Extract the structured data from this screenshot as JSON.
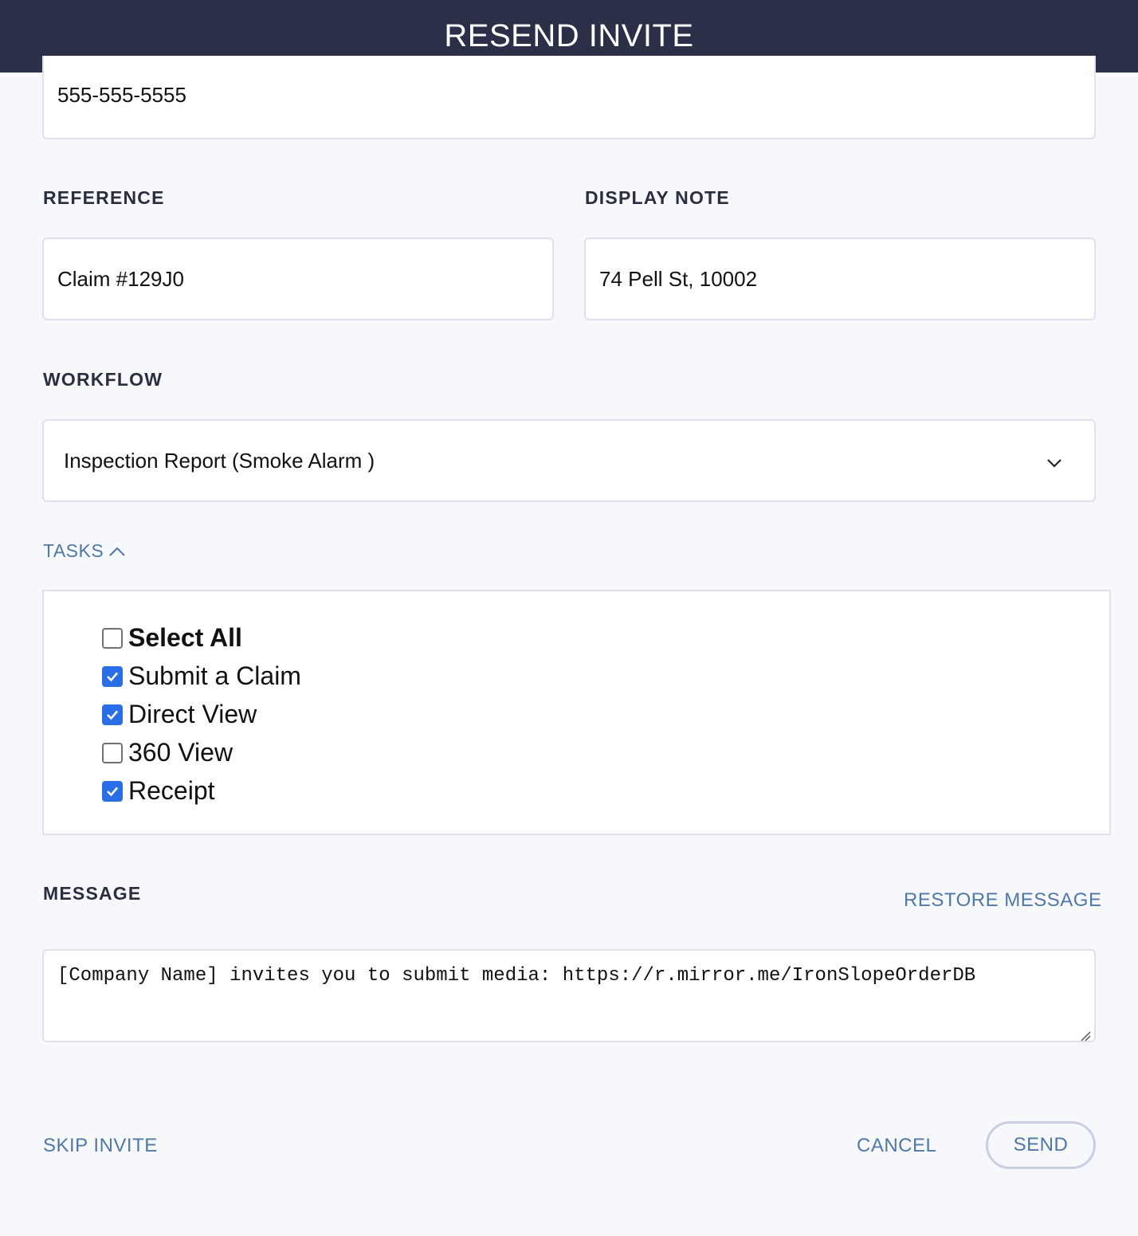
{
  "header": {
    "title": "RESEND INVITE"
  },
  "phone": {
    "value": "555-555-5555"
  },
  "reference": {
    "label": "REFERENCE",
    "value": "Claim #129J0"
  },
  "display_note": {
    "label": "DISPLAY NOTE",
    "value": "74 Pell St, 10002"
  },
  "workflow": {
    "label": "WORKFLOW",
    "selected": "Inspection Report (Smoke Alarm )"
  },
  "tasks": {
    "toggle_label": "TASKS",
    "expanded": true,
    "items": [
      {
        "label": "Select All",
        "checked": false
      },
      {
        "label": "Submit a Claim",
        "checked": true
      },
      {
        "label": "Direct View",
        "checked": true
      },
      {
        "label": "360 View",
        "checked": false
      },
      {
        "label": "Receipt",
        "checked": true
      }
    ]
  },
  "message": {
    "label": "MESSAGE",
    "restore_label": "RESTORE MESSAGE",
    "value": "[Company Name] invites you to submit media: https://r.mirror.me/IronSlopeOrderDB"
  },
  "footer": {
    "skip_label": "SKIP INVITE",
    "cancel_label": "CANCEL",
    "send_label": "SEND"
  },
  "colors": {
    "header_bg": "#2c2f48",
    "accent": "#4f78a6",
    "checkbox": "#2a6ee6"
  }
}
